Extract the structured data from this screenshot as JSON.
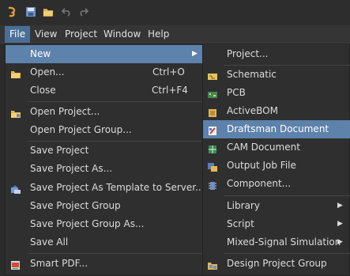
{
  "toolbar": {
    "icons": [
      "app-logo-icon",
      "save-icon",
      "open-folder-icon",
      "undo-icon",
      "redo-icon"
    ]
  },
  "menubar": {
    "items": [
      "File",
      "View",
      "Project",
      "Window",
      "Help"
    ]
  },
  "file_menu": {
    "items": [
      {
        "label": "New",
        "shortcut": "",
        "submenu": true
      },
      {
        "label": "Open...",
        "shortcut": "Ctrl+O"
      },
      {
        "label": "Close",
        "shortcut": "Ctrl+F4"
      },
      {
        "label": "Open Project..."
      },
      {
        "label": "Open Project Group..."
      },
      {
        "label": "Save Project"
      },
      {
        "label": "Save Project As..."
      },
      {
        "label": "Save Project As Template to Server..."
      },
      {
        "label": "Save Project Group"
      },
      {
        "label": "Save Project Group As..."
      },
      {
        "label": "Save All"
      },
      {
        "label": "Smart PDF..."
      }
    ]
  },
  "new_submenu": {
    "items": [
      {
        "label": "Project..."
      },
      {
        "label": "Schematic"
      },
      {
        "label": "PCB"
      },
      {
        "label": "ActiveBOM"
      },
      {
        "label": "Draftsman Document"
      },
      {
        "label": "CAM Document"
      },
      {
        "label": "Output Job File"
      },
      {
        "label": "Component..."
      },
      {
        "label": "Library"
      },
      {
        "label": "Script"
      },
      {
        "label": "Mixed-Signal Simulation"
      },
      {
        "label": "Design Project Group"
      }
    ]
  },
  "colors": {
    "menubar_active": "#4a6f96",
    "highlight": "#5d82ab",
    "menu_bg": "#2f2f2f"
  }
}
